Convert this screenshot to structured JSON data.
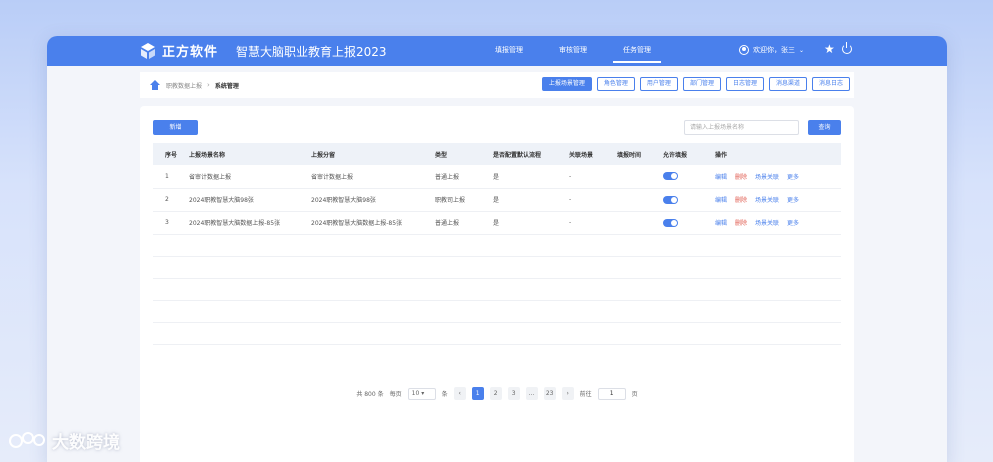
{
  "header": {
    "brand": "正方软件",
    "app_title": "智慧大脑职业教育上报2023",
    "nav": [
      {
        "label": "填报管理",
        "active": false
      },
      {
        "label": "审核管理",
        "active": false
      },
      {
        "label": "任务管理",
        "active": true
      }
    ],
    "user_greeting": "欢迎你，张三",
    "accent_color": "#4a80ec"
  },
  "breadcrumb": {
    "parent": "职教数据上报",
    "current": "系统管理"
  },
  "tabs": [
    {
      "label": "上报场景管理",
      "active": true
    },
    {
      "label": "角色管理",
      "active": false
    },
    {
      "label": "用户管理",
      "active": false
    },
    {
      "label": "部门管理",
      "active": false
    },
    {
      "label": "日志管理",
      "active": false
    },
    {
      "label": "消息渠道",
      "active": false
    },
    {
      "label": "消息日志",
      "active": false
    }
  ],
  "toolbar": {
    "add_label": "新增",
    "search_placeholder": "请输入上报场景名称",
    "search_label": "查询"
  },
  "table": {
    "columns": [
      "序号",
      "上报场景名称",
      "上报分留",
      "类型",
      "是否配置默认流程",
      "关联场景",
      "填报时间",
      "允许填报",
      "操作"
    ],
    "rows": [
      {
        "idx": "1",
        "name": "省审计数据上报",
        "group": "省审计数据上报",
        "type": "普通上报",
        "default_flow": "是",
        "related": "-",
        "time": "",
        "allow": true
      },
      {
        "idx": "2",
        "name": "2024职教智慧大脑98张",
        "group": "2024职教智慧大脑98张",
        "type": "职教司上报",
        "default_flow": "是",
        "related": "-",
        "time": "",
        "allow": true
      },
      {
        "idx": "3",
        "name": "2024职教智慧大脑数据上报-85张",
        "group": "2024职教智慧大脑数据上报-85张",
        "type": "普通上报",
        "default_flow": "是",
        "related": "-",
        "time": "",
        "allow": true
      }
    ],
    "actions": {
      "edit": "编辑",
      "delete": "删除",
      "related": "场景关联",
      "more": "更多"
    }
  },
  "pagination": {
    "total": "共 800 条",
    "page_size_label": "每页",
    "page_size": "10",
    "unit": "条",
    "pages": [
      "1",
      "2",
      "3",
      "...",
      "23"
    ],
    "current": "1",
    "goto_label": "前往",
    "goto_value": "1",
    "page_suffix": "页"
  },
  "watermark": "大数跨境"
}
